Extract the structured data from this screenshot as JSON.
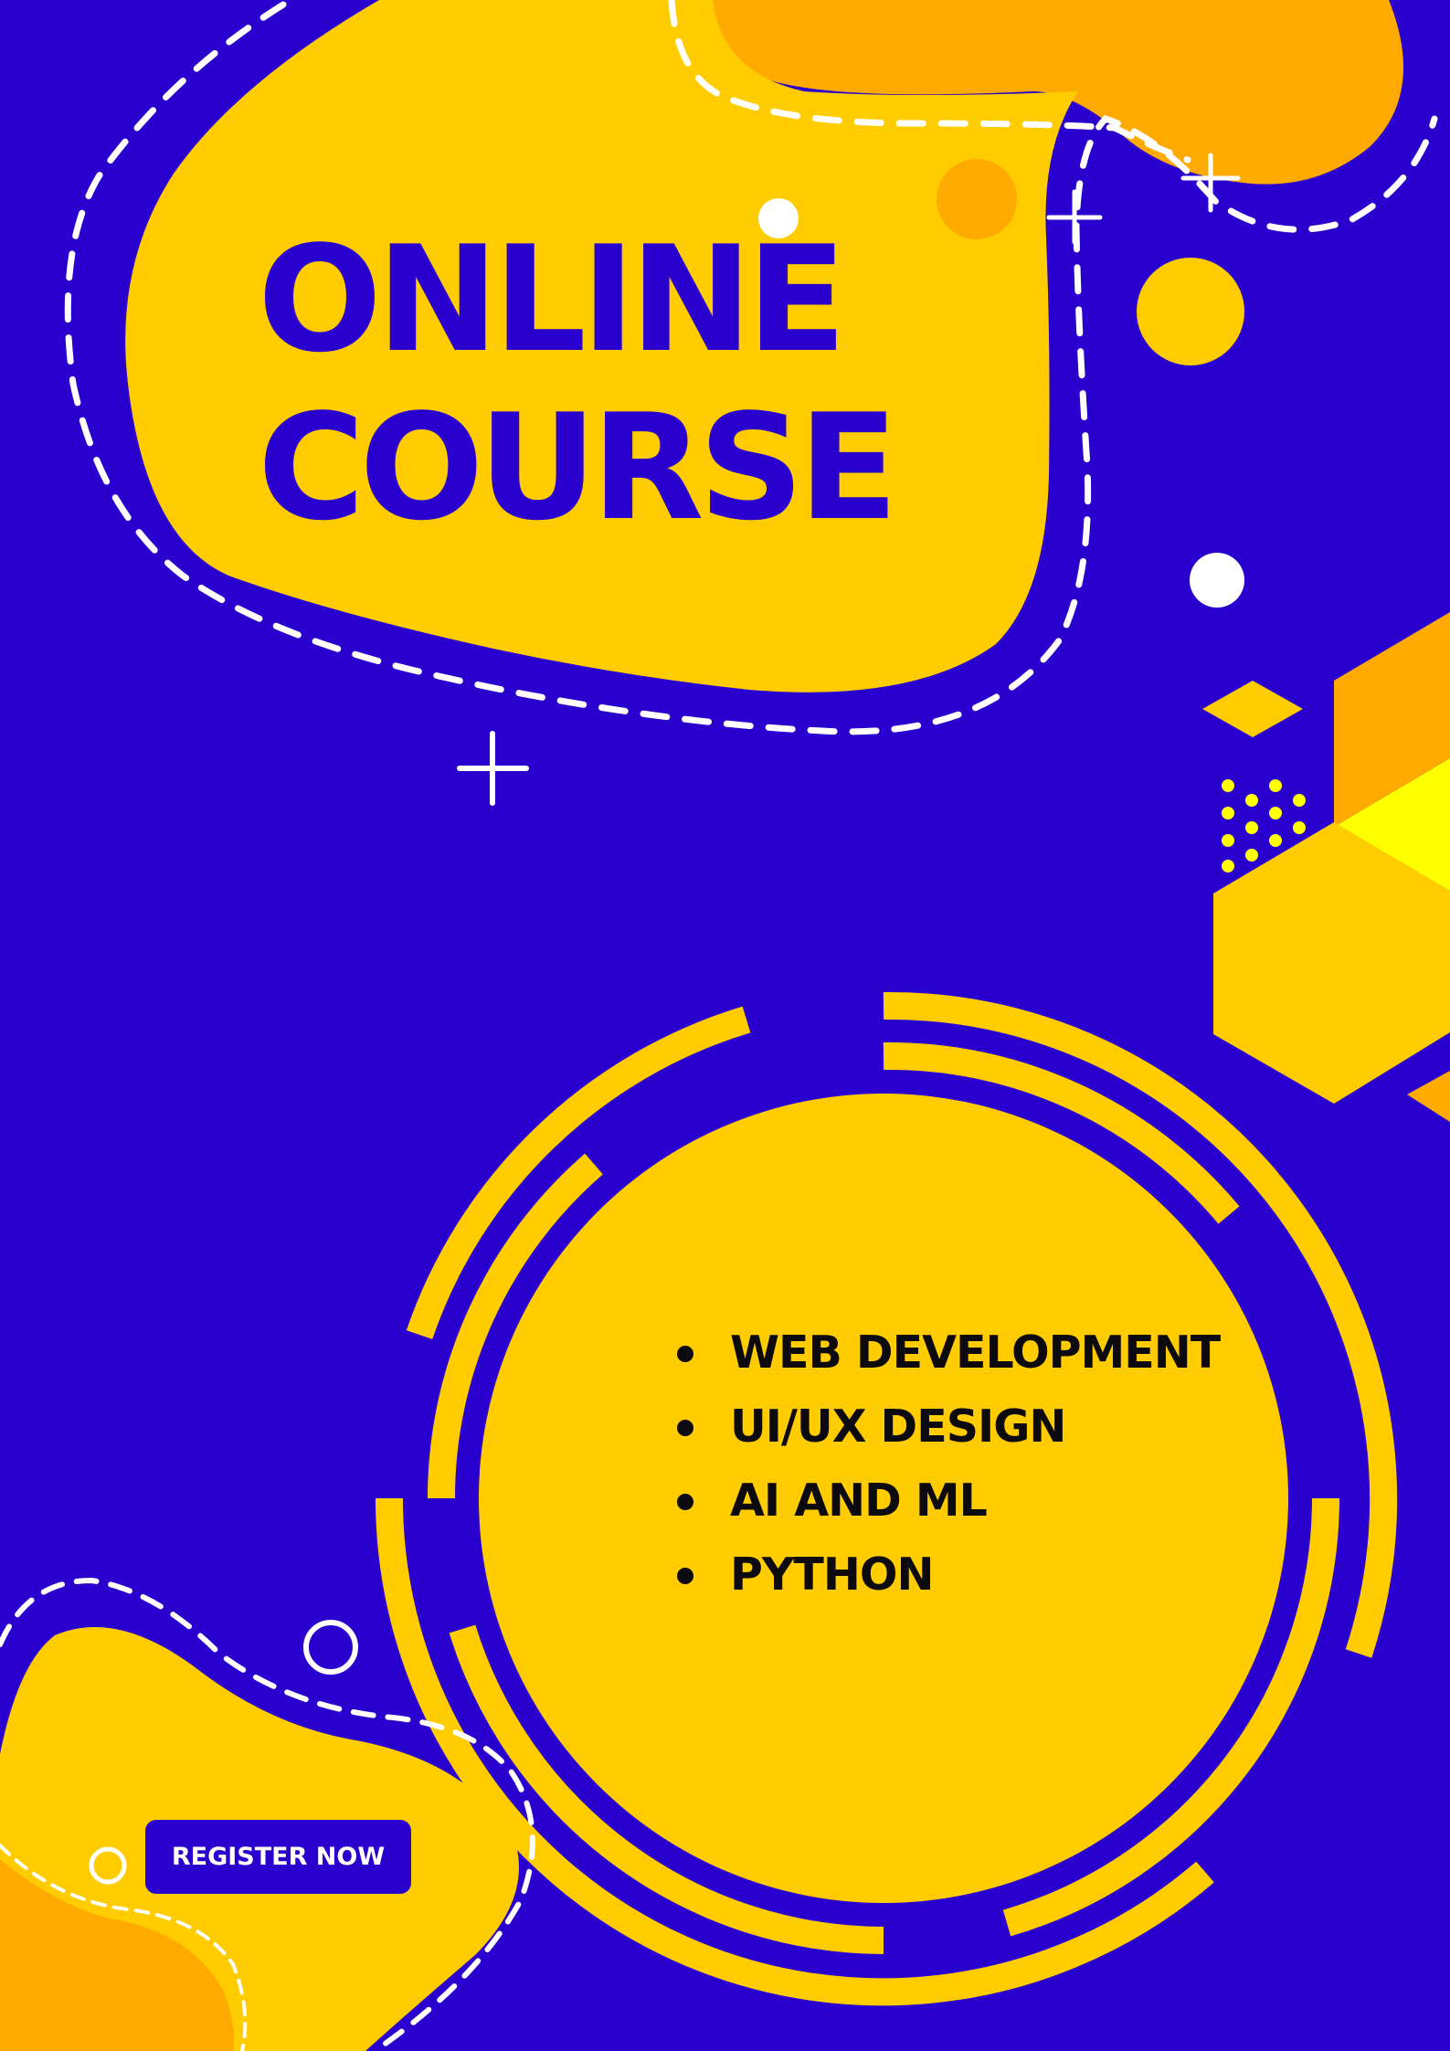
{
  "poster": {
    "title_line_1": "ONLINE",
    "title_line_2": "COURSE",
    "courses": [
      "WEB DEVELOPMENT",
      "UI/UX DESIGN",
      "AI AND ML",
      "PYTHON"
    ],
    "register_label": "REGISTER NOW"
  },
  "colors": {
    "background": "#2a00cf",
    "yellow": "#ffcc00",
    "orange": "#ffaa00",
    "lemon": "#ffff00",
    "white": "#ffffff",
    "text_dark": "#0c0a0f"
  },
  "icons": [
    "plus-icon",
    "circle-outline-icon",
    "dot-grid-icon",
    "diamond-icon",
    "hexagon-icon"
  ]
}
